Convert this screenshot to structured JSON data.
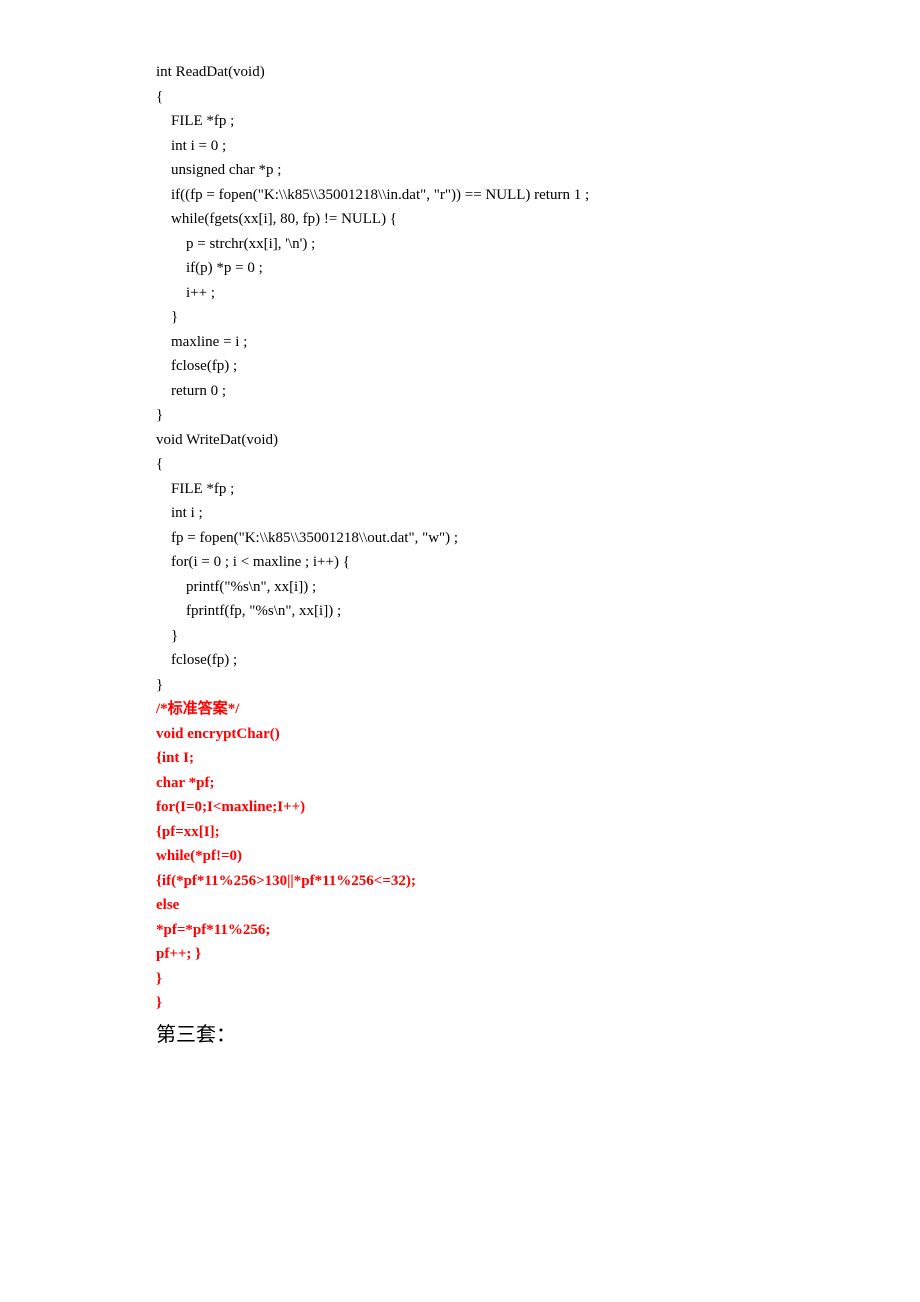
{
  "code": {
    "l1": "int ReadDat(void)",
    "l2": "{",
    "l3": "    FILE *fp ;",
    "l4": "    int i = 0 ;",
    "l5": "    unsigned char *p ;",
    "l6": "    if((fp = fopen(\"K:\\\\k85\\\\35001218\\\\in.dat\", \"r\")) == NULL) return 1 ;",
    "l7": "    while(fgets(xx[i], 80, fp) != NULL) {",
    "l8": "        p = strchr(xx[i], '\\n') ;",
    "l9": "        if(p) *p = 0 ;",
    "l10": "        i++ ;",
    "l11": "    }",
    "l12": "    maxline = i ;",
    "l13": "    fclose(fp) ;",
    "l14": "    return 0 ;",
    "l15": "}",
    "l16": "void WriteDat(void)",
    "l17": "{",
    "l18": "    FILE *fp ;",
    "l19": "    int i ;",
    "l20": "    fp = fopen(\"K:\\\\k85\\\\35001218\\\\out.dat\", \"w\") ;",
    "l21": "    for(i = 0 ; i < maxline ; i++) {",
    "l22": "        printf(\"%s\\n\", xx[i]) ;",
    "l23": "        fprintf(fp, \"%s\\n\", xx[i]) ;",
    "l24": "    }",
    "l25": "    fclose(fp) ;",
    "l26": "}"
  },
  "answer": {
    "label_pre": "/*",
    "label_cn": "标准答案",
    "label_post": "*/",
    "a1": "void encryptChar()",
    "a2": "{int I;",
    "a3": "char *pf;",
    "a4": "for(I=0;I<maxline;I++)",
    "a5": "{pf=xx[I];",
    "a6": "while(*pf!=0)",
    "a7": "{if(*pf*11%256>130||*pf*11%256<=32);",
    "a8": "else",
    "a9": "*pf=*pf*11%256;",
    "a10": "pf++; }",
    "a11": "}",
    "a12": "}"
  },
  "heading": "第三套："
}
